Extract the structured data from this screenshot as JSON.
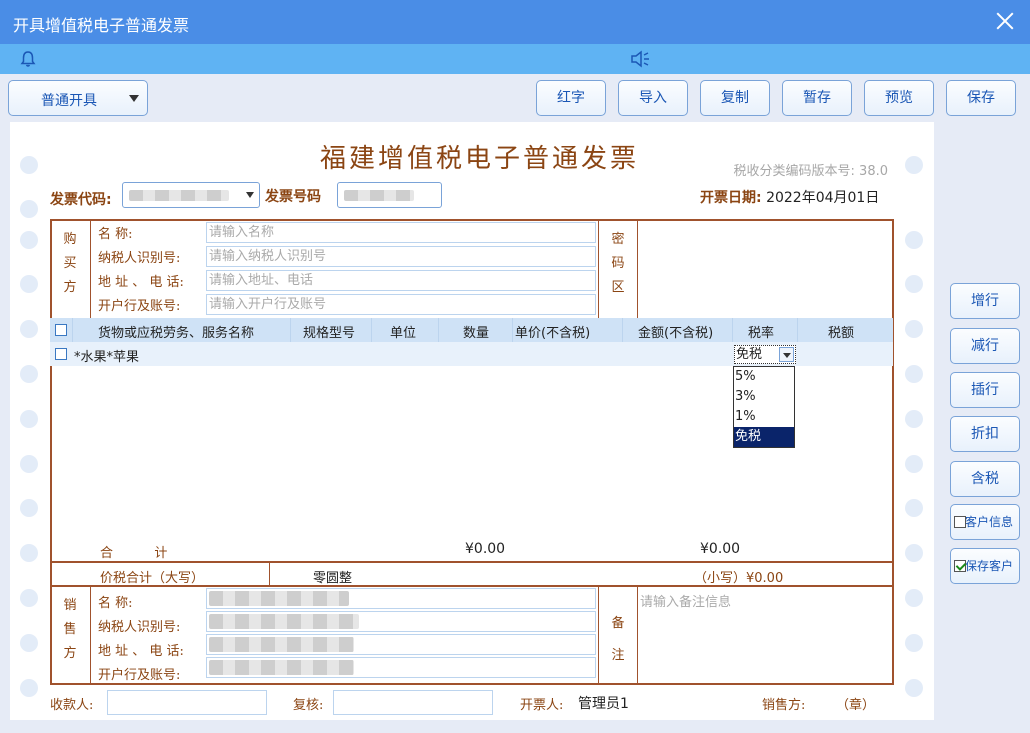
{
  "window": {
    "title": "开具增值税电子普通发票"
  },
  "toolbar": {
    "mode_value": "普通开具",
    "buttons": [
      "红字",
      "导入",
      "复制",
      "暂存",
      "预览",
      "保存"
    ]
  },
  "invoice": {
    "title": "福建增值税电子普通发票",
    "version": "税收分类编码版本号: 38.0",
    "code_label": "发票代码:",
    "number_label": "发票号码",
    "date_label": "开票日期:",
    "date_value": "2022年04月01日"
  },
  "buyer": {
    "side_label": [
      "购",
      "买",
      "方"
    ],
    "name_label": "名    称:",
    "tax_label": "纳税人识别号:",
    "addr_label": "地 址 、 电 话:",
    "bank_label": "开户行及账号:",
    "name_placeholder": "请输入名称",
    "tax_placeholder": "请输入纳税人识别号",
    "addr_placeholder": "请输入地址、电话",
    "bank_placeholder": "请输入开户行及账号",
    "cipher_label": [
      "密",
      "码",
      "区"
    ]
  },
  "table": {
    "headers": [
      "货物或应税劳务、服务名称",
      "规格型号",
      "单位",
      "数量",
      "单价(不含税)",
      "金额(不含税)",
      "税率",
      "税额"
    ],
    "rows": [
      {
        "name": "*水果*苹果",
        "rate": "免税"
      }
    ]
  },
  "rate_dropdown": {
    "options": [
      "5%",
      "3%",
      "1%",
      "免税"
    ],
    "selected": "免税"
  },
  "totals": {
    "label": "合          计",
    "amount": "¥0.00",
    "tax": "¥0.00",
    "total_caps_label": "价税合计（大写）",
    "total_caps_value": "零圆整",
    "total_small": "（小写）¥0.00"
  },
  "seller": {
    "side_label": [
      "销",
      "售",
      "方"
    ],
    "name_label": "名    称:",
    "tax_label": "纳税人识别号:",
    "addr_label": "地 址 、 电 话:",
    "bank_label": "开户行及账号:",
    "remark_label": [
      "备",
      "注"
    ],
    "remark_placeholder": "请输入备注信息"
  },
  "footer": {
    "payee_label": "收款人:",
    "reviewer_label": "复核:",
    "drawer_label": "开票人:",
    "drawer_value": "管理员1",
    "seller_label": "销售方:",
    "seal": "（章）"
  },
  "side_buttons": [
    "增行",
    "减行",
    "插行",
    "折扣",
    "含税"
  ],
  "side_checks": [
    {
      "label": "客户信息",
      "checked": false
    },
    {
      "label": "保存客户",
      "checked": true
    }
  ],
  "colors": {
    "titlebar": "#4a8de6",
    "notice": "#5fb3f3",
    "accent": "#1b57b5",
    "invoice_brown": "#8b4513"
  }
}
